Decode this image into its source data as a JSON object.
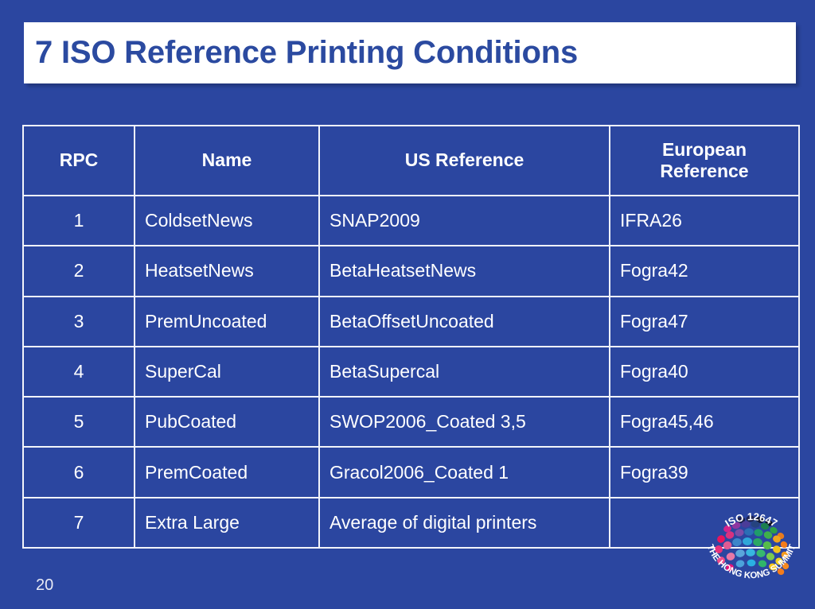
{
  "slide": {
    "title": "7 ISO Reference Printing Conditions",
    "page_number": "20",
    "background_color": "#2B46A0",
    "title_box_color": "#FFFFFF",
    "title_text_color": "#2B4AA0",
    "table_border_color": "#F2F4FA",
    "table_text_color": "#FFFFFF"
  },
  "table": {
    "headers": [
      "RPC",
      "Name",
      "US Reference",
      "European\nReference"
    ],
    "headers_flat": [
      "RPC",
      "Name",
      "US Reference",
      "European Reference"
    ],
    "header_eu_line1": "European",
    "header_eu_line2": "Reference",
    "rows": [
      {
        "rpc": "1",
        "name": "ColdsetNews",
        "us": "SNAP2009",
        "eu": "IFRA26"
      },
      {
        "rpc": "2",
        "name": "HeatsetNews",
        "us": "BetaHeatsetNews",
        "eu": "Fogra42"
      },
      {
        "rpc": "3",
        "name": "PremUncoated",
        "us": "BetaOffsetUncoated",
        "eu": "Fogra47"
      },
      {
        "rpc": "4",
        "name": "SuperCal",
        "us": "BetaSupercal",
        "eu": "Fogra40"
      },
      {
        "rpc": "5",
        "name": "PubCoated",
        "us": "SWOP2006_Coated 3,5",
        "eu": "Fogra45,46"
      },
      {
        "rpc": "6",
        "name": "PremCoated",
        "us": "Gracol2006_Coated 1",
        "eu": "Fogra39"
      },
      {
        "rpc": "7",
        "name": "Extra Large",
        "us": "Average of digital printers",
        "eu": ""
      }
    ]
  },
  "logo": {
    "name": "iso-12647-hong-kong-summit-logo",
    "top_text": "ISO 12647",
    "bottom_text": "THE HONG KONG SUMMIT",
    "dot_colors": [
      "#1B1F4B",
      "#232A5E",
      "#151833",
      "#0E1026",
      "#E0147A",
      "#C3208B",
      "#5B3A9B",
      "#2E3A86",
      "#1C7F4E",
      "#27A148",
      "#E87B1E",
      "#E8145E",
      "#D9327F",
      "#7B4DA8",
      "#2B6FB5",
      "#1F9C6B",
      "#3FB04A",
      "#F0A41C",
      "#F47C1B",
      "#E8327A",
      "#E05A93",
      "#3E86C9",
      "#2FA7D9",
      "#2BA863",
      "#56BC4A",
      "#F2C21C",
      "#F59A1B",
      "#EF4C8A",
      "#E878A6",
      "#5AA6DB",
      "#38B6E0",
      "#36B86F",
      "#7BC94E",
      "#F4D324",
      "#F68A1F",
      "#E8147A",
      "#4CA3DB",
      "#2AB0E2",
      "#2FB56A",
      "#F6C81E",
      "#F47C1B"
    ]
  }
}
